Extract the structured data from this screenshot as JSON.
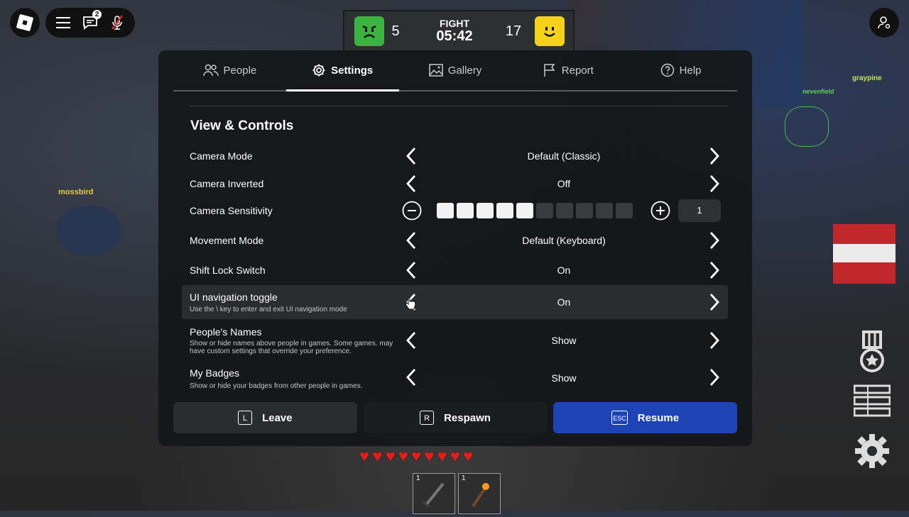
{
  "top_bar": {
    "chat_badge_count": "2"
  },
  "scoreboard": {
    "left_score": "5",
    "right_score": "17",
    "label": "FIGHT",
    "timer": "05:42"
  },
  "tabs": [
    {
      "label": "People",
      "icon": "people-icon"
    },
    {
      "label": "Settings",
      "icon": "gear-icon"
    },
    {
      "label": "Gallery",
      "icon": "image-icon"
    },
    {
      "label": "Report",
      "icon": "flag-icon"
    },
    {
      "label": "Help",
      "icon": "help-icon"
    }
  ],
  "active_tab": "Settings",
  "section": {
    "title": "View & Controls",
    "rows": [
      {
        "label": "Camera Mode",
        "value": "Default (Classic)"
      },
      {
        "label": "Camera Inverted",
        "value": "Off"
      },
      {
        "label": "Camera Sensitivity",
        "value": "1",
        "filled_segments": 5,
        "total_segments": 10
      },
      {
        "label": "Movement Mode",
        "value": "Default (Keyboard)"
      },
      {
        "label": "Shift Lock Switch",
        "value": "On"
      },
      {
        "label": "UI navigation toggle",
        "desc": "Use the \\ key to enter and exit UI navigation mode",
        "value": "On"
      },
      {
        "label": "People's Names",
        "desc": "Show or hide names above people in games. Some games. may have custom settings that override your preference.",
        "value": "Show"
      },
      {
        "label": "My Badges",
        "desc": "Show or hide your badges from other people in games.",
        "value": "Show"
      }
    ]
  },
  "actions": [
    {
      "key": "L",
      "label": "Leave"
    },
    {
      "key": "R",
      "label": "Respawn"
    },
    {
      "key": "ESC",
      "label": "Resume"
    }
  ],
  "hud": {
    "hearts": 9,
    "hotbar": [
      {
        "slot": "1",
        "item": "sword"
      },
      {
        "slot": "1",
        "item": "torch"
      }
    ]
  },
  "nametags": [
    "mossbird",
    "graypine",
    "nevenfield"
  ],
  "colors": {
    "accent_blue": "#1e43b7",
    "panel_bg": "#151619",
    "heart_red": "#e0201c",
    "green_team": "#3cb340",
    "yellow_team": "#f5d21a"
  }
}
